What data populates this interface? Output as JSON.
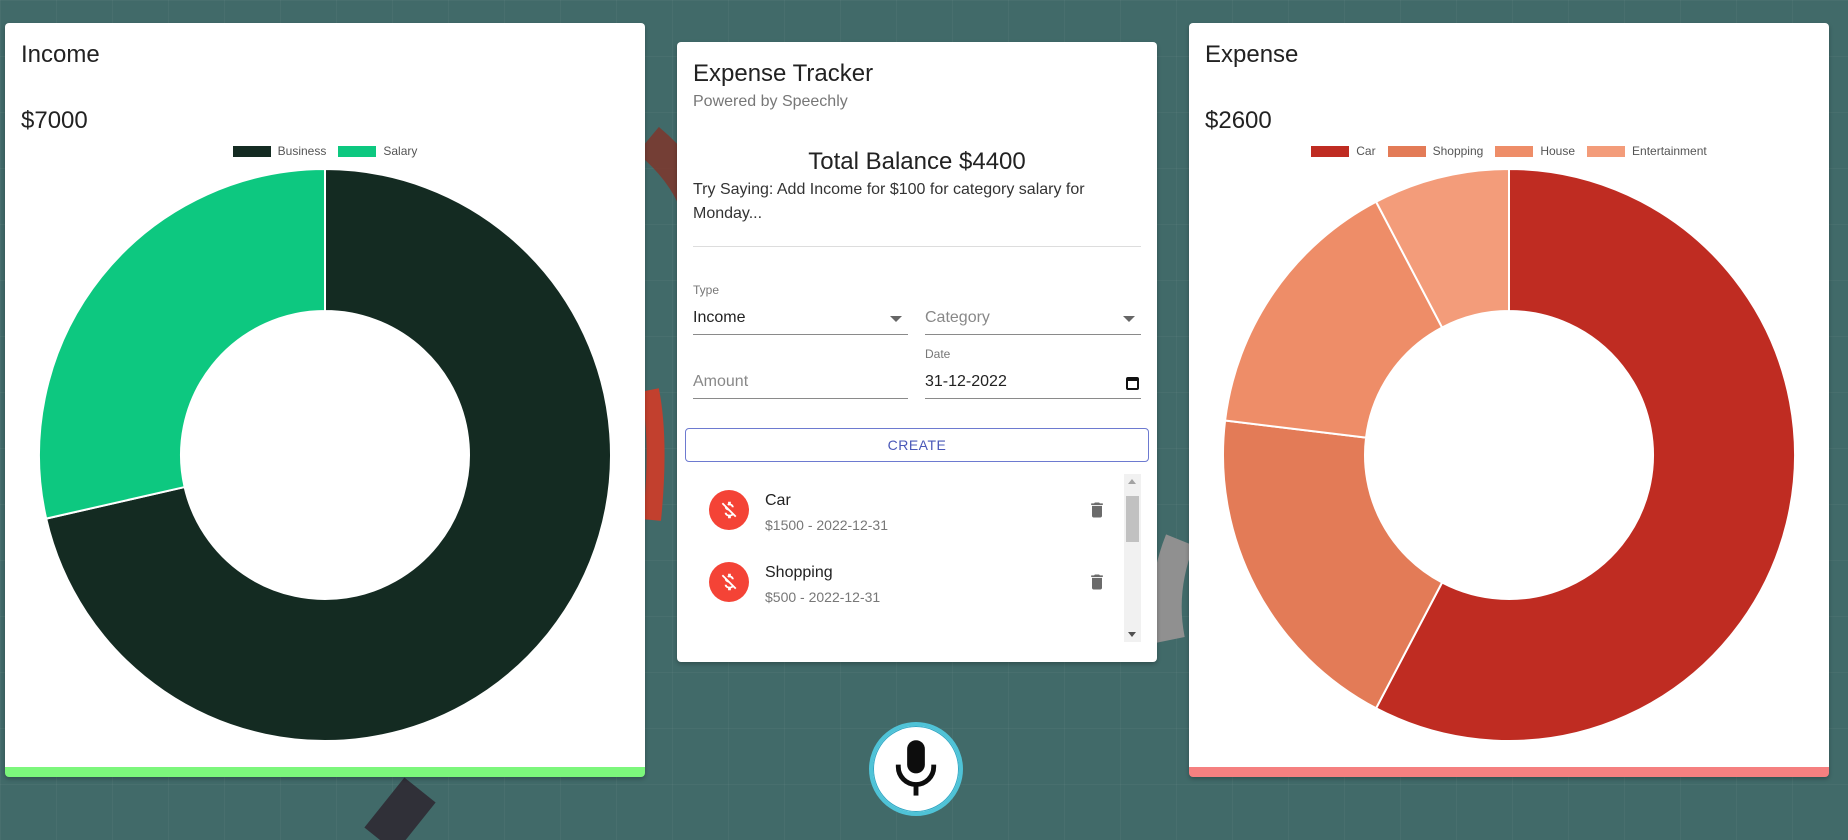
{
  "income": {
    "title": "Income",
    "amount": "$7000",
    "legend": [
      {
        "label": "Business",
        "color": "#142b22"
      },
      {
        "label": "Salary",
        "color": "#0dc880"
      }
    ]
  },
  "expense": {
    "title": "Expense",
    "amount": "$2600",
    "legend": [
      {
        "label": "Car",
        "color": "#bf2c22"
      },
      {
        "label": "Shopping",
        "color": "#e37b57"
      },
      {
        "label": "House",
        "color": "#ee8d68"
      },
      {
        "label": "Entertainment",
        "color": "#f39c7a"
      }
    ]
  },
  "tracker": {
    "title": "Expense Tracker",
    "subtitle": "Powered by Speechly",
    "balance": "Total Balance $4400",
    "hint": "Try Saying: Add Income for $100 for category salary for Monday...",
    "form": {
      "type_label": "Type",
      "type_value": "Income",
      "category_placeholder": "Category",
      "amount_placeholder": "Amount",
      "date_label": "Date",
      "date_value": "31-12-2022",
      "create_label": "CREATE"
    },
    "transactions": [
      {
        "name": "Car",
        "detail": "$1500 - 2022-12-31"
      },
      {
        "name": "Shopping",
        "detail": "$500 - 2022-12-31"
      }
    ]
  },
  "chart_data": [
    {
      "type": "pie",
      "title": "",
      "categories": [
        "Business",
        "Salary"
      ],
      "values": [
        5000,
        2000
      ],
      "colors": [
        "#142b22",
        "#0dc880"
      ],
      "legend": "top"
    },
    {
      "type": "pie",
      "title": "",
      "categories": [
        "Car",
        "Shopping",
        "House",
        "Entertainment"
      ],
      "values": [
        1500,
        500,
        400,
        200
      ],
      "colors": [
        "#bf2c22",
        "#e37b57",
        "#ee8d68",
        "#f39c7a"
      ],
      "legend": "top"
    }
  ],
  "icons": {
    "transaction": "money-off-icon",
    "delete": "delete-icon",
    "mic": "mic-icon"
  }
}
